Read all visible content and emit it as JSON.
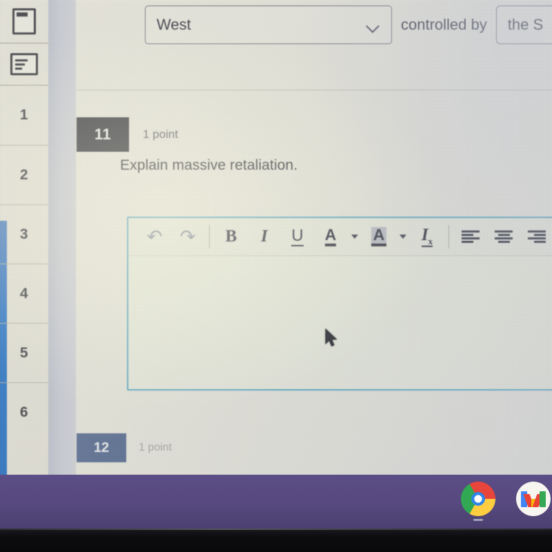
{
  "icon_rail": {
    "items": [
      {
        "icon": "document-page-icon",
        "name": "questions-view"
      },
      {
        "icon": "outline-list-icon",
        "name": "responses-view"
      }
    ]
  },
  "question_nav": {
    "numbers": [
      "1",
      "2",
      "3",
      "4",
      "5",
      "6"
    ]
  },
  "top_row": {
    "dropdown": {
      "value": "West",
      "icon": "chevron-down-icon"
    },
    "connector_text": "controlled by",
    "answer_box": {
      "value": "the S"
    }
  },
  "question_11": {
    "number": "11",
    "points": "1 point",
    "prompt": "Explain massive retaliation."
  },
  "question_12": {
    "number": "12",
    "points": "1 point"
  },
  "editor": {
    "content": "",
    "placeholder": "",
    "toolbar": [
      {
        "name": "undo-button",
        "icon": "undo-icon",
        "glyph": "↶"
      },
      {
        "name": "redo-button",
        "icon": "redo-icon",
        "glyph": "↷"
      },
      {
        "name": "bold-button",
        "icon": "bold-icon",
        "glyph": "B"
      },
      {
        "name": "italic-button",
        "icon": "italic-icon",
        "glyph": "I"
      },
      {
        "name": "underline-button",
        "icon": "underline-icon",
        "glyph": "U"
      },
      {
        "name": "text-color-button",
        "icon": "text-color-icon",
        "glyph": "A"
      },
      {
        "name": "highlight-button",
        "icon": "highlight-color-icon",
        "glyph": "A"
      },
      {
        "name": "clear-format-button",
        "icon": "clear-formatting-icon",
        "glyph": "I"
      },
      {
        "name": "align-left-button",
        "icon": "align-left-icon",
        "glyph": ""
      },
      {
        "name": "align-center-button",
        "icon": "align-center-icon",
        "glyph": ""
      },
      {
        "name": "align-right-button",
        "icon": "align-right-icon",
        "glyph": ""
      }
    ]
  },
  "taskbar": {
    "items": [
      {
        "name": "chrome-shortcut",
        "icon": "chrome-icon",
        "label": "Chrome"
      },
      {
        "name": "gmail-shortcut",
        "icon": "gmail-icon",
        "label": "Gmail"
      }
    ]
  },
  "colors": {
    "page_bg": "#eceadf",
    "badge_11": "#31323a",
    "badge_12": "#445b88",
    "editor_border": "#55a8c4",
    "taskbar": "#574a7f",
    "gutter": "#c9ccd6",
    "left_accent": "#1d6fc9"
  }
}
